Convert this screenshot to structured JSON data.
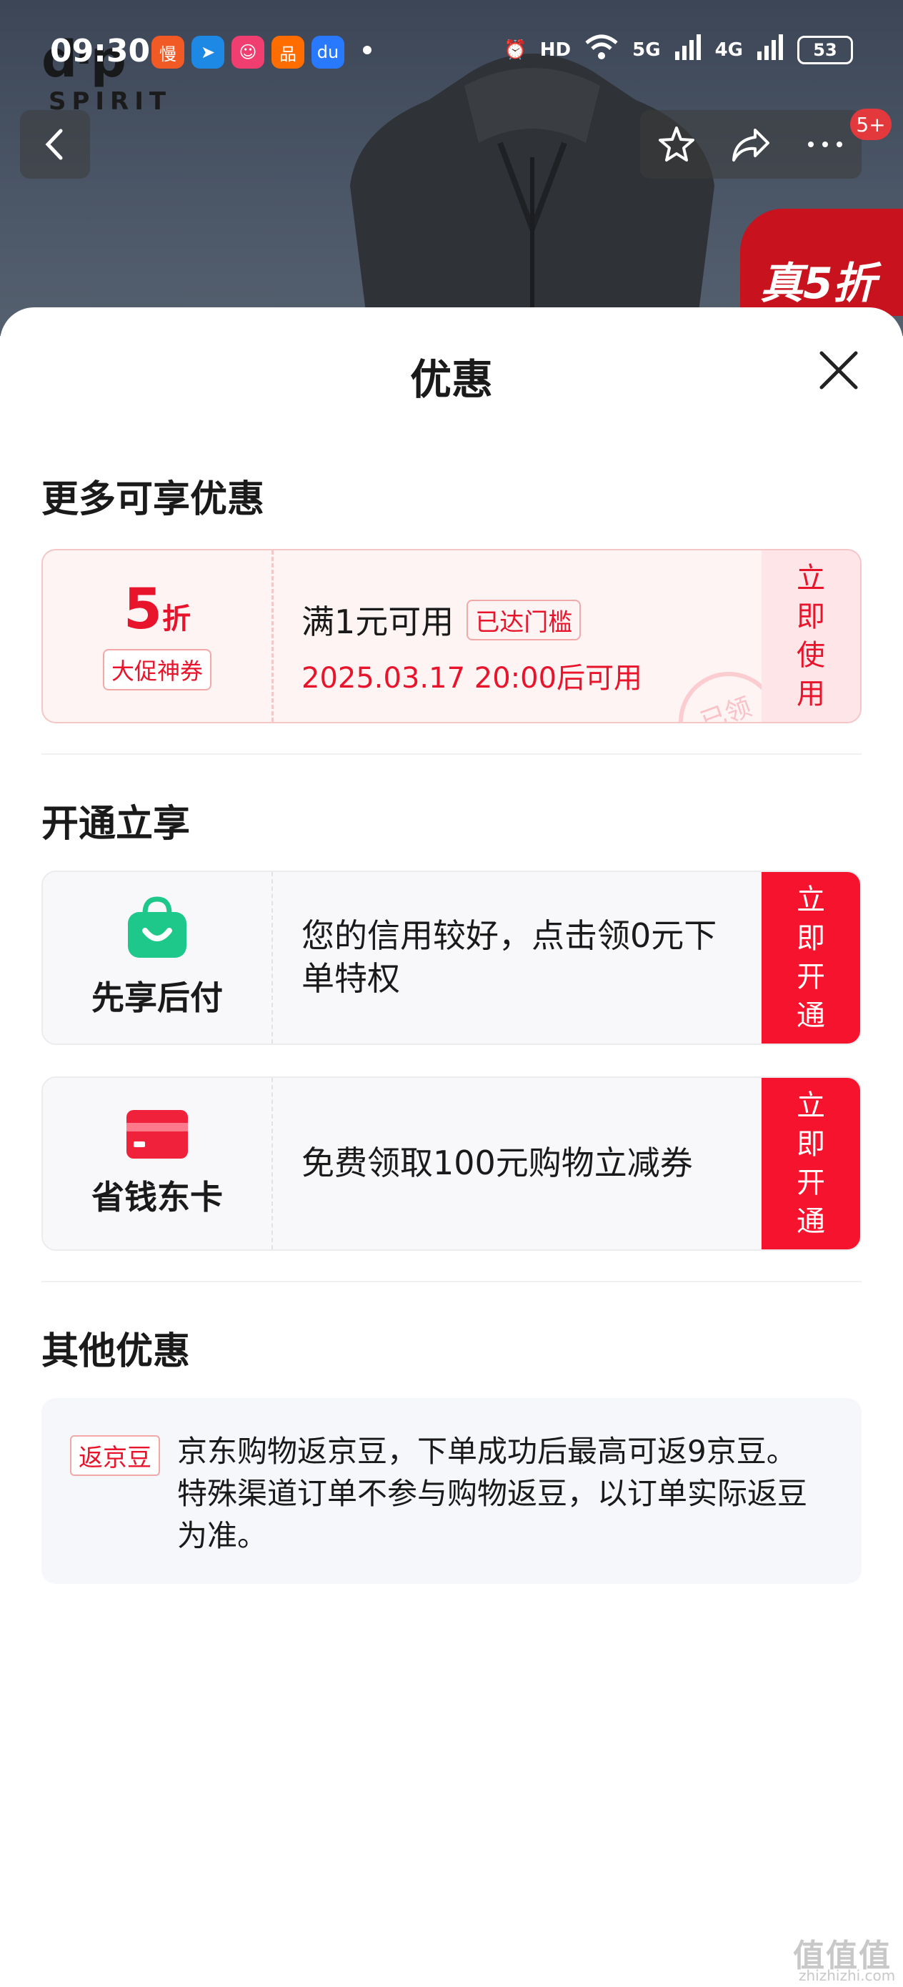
{
  "status_bar": {
    "time": "09:30",
    "battery": "53",
    "net1": "5G",
    "net2": "4G",
    "hd": "HD"
  },
  "hero": {
    "brand_big": "d·p",
    "brand_small": "SPIRIT",
    "promo_tag": "真5折",
    "cart_badge": "5+"
  },
  "sheet": {
    "title": "优惠"
  },
  "sections": {
    "more": "更多可享优惠",
    "open": "开通立享",
    "other": "其他优惠"
  },
  "coupon": {
    "value": "5",
    "unit": "折",
    "tag": "大促神券",
    "condition": "满1元可用",
    "threshold": "已达门槛",
    "valid_time": "2025.03.17 20:00后可用",
    "action": "立即使用",
    "stamp": "已领"
  },
  "features": [
    {
      "label": "先享后付",
      "text": "您的信用较好，点击领0元下单特权",
      "action": "立即开通",
      "icon": "shopping-bag-icon",
      "color": "#1ec78a"
    },
    {
      "label": "省钱东卡",
      "text": "免费领取100元购物立减券",
      "action": "立即开通",
      "icon": "card-icon",
      "color": "#f0213a"
    }
  ],
  "other": {
    "tag": "返京豆",
    "text": "京东购物返京豆，下单成功后最高可返9京豆。特殊渠道订单不参与购物返豆，以订单实际返豆为准。"
  },
  "watermark": {
    "main": "值值值",
    "sub": "zhizhizhi.com"
  }
}
